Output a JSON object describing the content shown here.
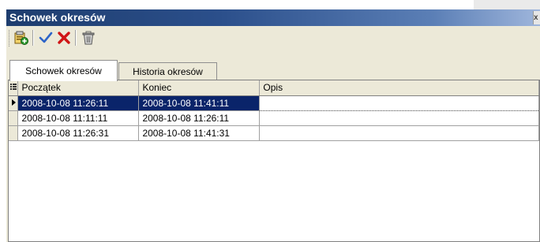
{
  "window": {
    "title": "Schowek okresów",
    "close_glyph": "x"
  },
  "toolbar": {
    "buttons": [
      {
        "icon": "add-period-icon"
      },
      {
        "icon": "checkmark-icon"
      },
      {
        "icon": "delete-x-icon"
      },
      {
        "icon": "trash-icon"
      }
    ]
  },
  "tabs": [
    {
      "label": "Schowek okresów",
      "active": true
    },
    {
      "label": "Historia okresów",
      "active": false
    }
  ],
  "grid": {
    "columns": [
      "Początek",
      "Koniec",
      "Opis"
    ],
    "rows": [
      {
        "start": "2008-10-08 11:26:11",
        "end": "2008-10-08 11:41:11",
        "desc": "",
        "selected": true
      },
      {
        "start": "2008-10-08 11:11:11",
        "end": "2008-10-08 11:26:11",
        "desc": "",
        "selected": false
      },
      {
        "start": "2008-10-08 11:26:31",
        "end": "2008-10-08 11:41:31",
        "desc": "",
        "selected": false
      }
    ]
  },
  "colors": {
    "selection": "#0a246a",
    "titlebar": "#2b4f8b",
    "panel": "#ece9d8"
  }
}
